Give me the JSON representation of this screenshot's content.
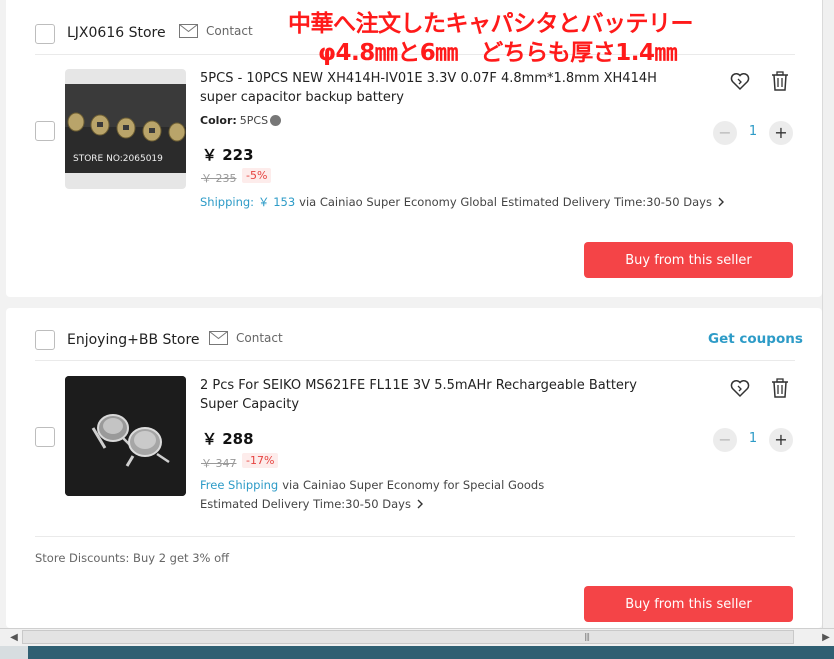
{
  "overlay": {
    "line1": "中華へ注文したキャパシタとバッテリー",
    "line2": "φ4.8㎜と6㎜　どちらも厚さ1.4㎜"
  },
  "store1": {
    "name": "LJX0616 Store",
    "contact": "Contact",
    "item": {
      "image_caption": "STORE NO:2065019",
      "title": "5PCS - 10PCS NEW XH414H-IV01E 3.3V 0.07F 4.8mm*1.8mm XH414H super capacitor backup battery",
      "color_label": "Color:",
      "color_value": "5PCS",
      "price": "￥ 223",
      "old_price": "￥ 235",
      "discount": "-5%",
      "shipping_label": "Shipping:",
      "shipping_cost": "￥ 153",
      "shipping_method": "via Cainiao Super Economy Global",
      "delivery": "Estimated Delivery Time:30-50 Days",
      "quantity": "1"
    },
    "buy_label": "Buy from this seller"
  },
  "store2": {
    "name": "Enjoying+BB Store",
    "contact": "Contact",
    "coupons": "Get coupons",
    "item": {
      "title": "2 Pcs For SEIKO MS621FE FL11E 3V 5.5mAHr Rechargeable Battery Super Capacity",
      "price": "￥ 288",
      "old_price": "￥ 347",
      "discount": "-17%",
      "shipping_label": "Free Shipping",
      "shipping_method": "via Cainiao Super Economy for Special Goods",
      "delivery": "Estimated Delivery Time:30-50 Days",
      "quantity": "1"
    },
    "store_discounts": "Store Discounts:  Buy 2 get 3% off",
    "buy_label": "Buy from this seller"
  },
  "colors": {
    "accent_blue": "#2d9bc7",
    "buy_red": "#f44447",
    "overlay_red": "#ff1a1a"
  },
  "icons": [
    "mail-icon",
    "heart-icon",
    "trash-icon",
    "minus-icon",
    "plus-icon",
    "chevron-right-icon",
    "scroll-left-icon",
    "scroll-right-icon"
  ]
}
